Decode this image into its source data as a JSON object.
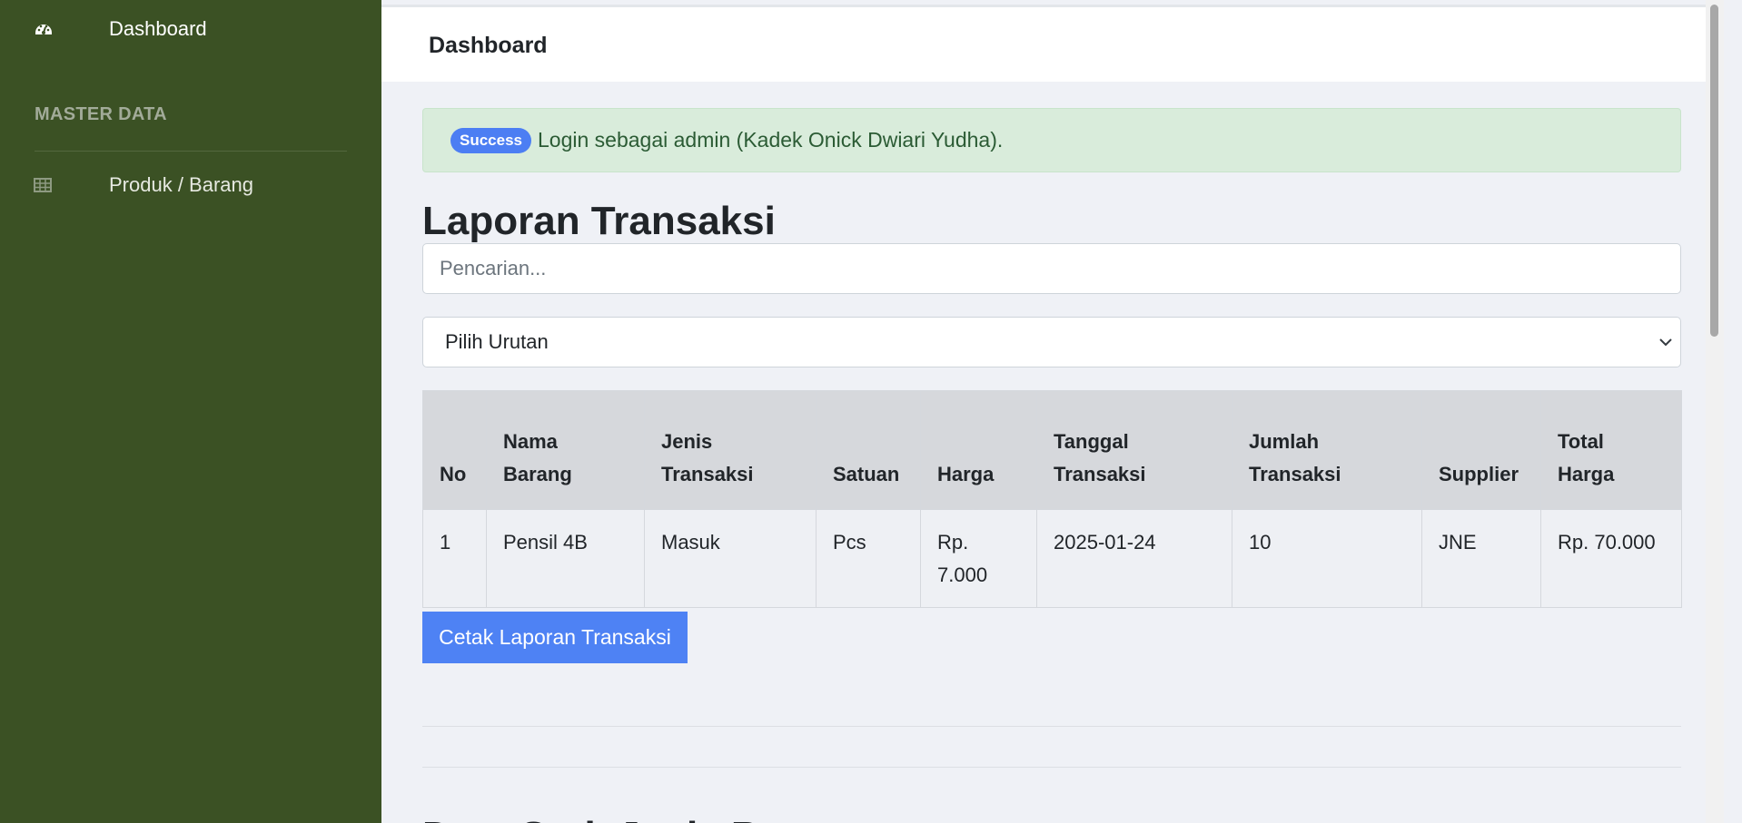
{
  "sidebar": {
    "dashboard_label": "Dashboard",
    "section_heading": "MASTER DATA",
    "produk_label": "Produk / Barang",
    "icons": {
      "dashboard": "tachometer-icon",
      "produk": "table-icon"
    }
  },
  "topbar": {
    "title": "Dashboard"
  },
  "alert": {
    "badge": "Success",
    "message": "Login sebagai admin (Kadek Onick Dwiari Yudha)."
  },
  "page": {
    "title": "Laporan Transaksi"
  },
  "search": {
    "placeholder": "Pencarian..."
  },
  "sort_select": {
    "selected": "Pilih Urutan"
  },
  "table": {
    "headers": [
      "No",
      "Nama Barang",
      "Jenis Transaksi",
      "Satuan",
      "Harga",
      "Tanggal Transaksi",
      "Jumlah Transaksi",
      "Supplier",
      "Total Harga"
    ],
    "rows": [
      [
        "1",
        "Pensil 4B",
        "Masuk",
        "Pcs",
        "Rp. 7.000",
        "2025-01-24",
        "10",
        "JNE",
        "Rp. 70.000"
      ]
    ]
  },
  "print_button": "Cetak Laporan Transaksi",
  "next_section_title": "Data Stok Jenis Barang",
  "colors": {
    "sidebar": "#3b5124",
    "accent": "#4e82f4",
    "alert_bg": "#d9ecdb",
    "alert_text": "#2b5b34"
  }
}
